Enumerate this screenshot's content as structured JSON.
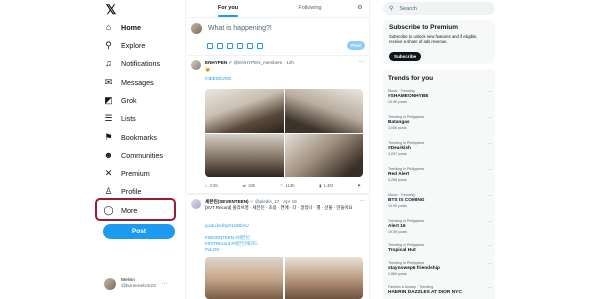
{
  "sidebar": {
    "logo": "𝕏",
    "items": [
      {
        "label": "Home",
        "icon": "home-icon"
      },
      {
        "label": "Explore",
        "icon": "search-icon"
      },
      {
        "label": "Notifications",
        "icon": "bell-icon"
      },
      {
        "label": "Messages",
        "icon": "mail-icon"
      },
      {
        "label": "Grok",
        "icon": "grok-icon"
      },
      {
        "label": "Lists",
        "icon": "list-icon"
      },
      {
        "label": "Bookmarks",
        "icon": "bookmark-icon"
      },
      {
        "label": "Communities",
        "icon": "people-icon"
      },
      {
        "label": "Premium",
        "icon": "x-icon"
      },
      {
        "label": "Profile",
        "icon": "person-icon"
      },
      {
        "label": "More",
        "icon": "more-circle-icon"
      }
    ],
    "post_label": "Post",
    "account": {
      "name": "Melvin",
      "handle": "@bonemelvin23"
    }
  },
  "timeline": {
    "tabs": [
      {
        "label": "For you"
      },
      {
        "label": "Following"
      }
    ],
    "compose": {
      "placeholder": "What is happening?!",
      "post_label": "Post"
    },
    "tweets": [
      {
        "name": "ENHYPEN",
        "handle": "@ENHYPEN_members · 12h",
        "text": "😺",
        "hashtag": "#JEESEUNG",
        "stats": {
          "replies": "3.0K",
          "reposts": "18K",
          "likes": "113K",
          "views": "1.4M"
        }
      },
      {
        "name": "세븐틴(SEVENTEEN)",
        "handle": "@pledis_17 · Apr 18",
        "text": "[SVT Record] 올리브영 · 세븐틴 · 조용 · 연애 · 다 · 알았나 · 별 · 선물 · 만들어요",
        "link": "youtu.be/hpO1sWbAU",
        "hashtags": "#SEVENTEEN #세븐틴",
        "hashtags2": "#SVTRecord #세븐틴레코드",
        "hashtags3": "#VLOG"
      }
    ]
  },
  "right": {
    "search_placeholder": "Search",
    "premium": {
      "title": "Subscribe to Premium",
      "desc": "Subscribe to unlock new features and if eligible, receive a share of ads revenue.",
      "button": "Subscribe"
    },
    "trends_title": "Trends for you",
    "trends": [
      {
        "context": "Music · Trending",
        "name": "#SHAMEONHYBE",
        "count": "19.9K posts"
      },
      {
        "context": "Trending in Philippines",
        "name": "Batangas",
        "count": "3,006 posts"
      },
      {
        "context": "Trending in Philippines",
        "name": "#Dearkish",
        "count": "4,297 posts"
      },
      {
        "context": "Trending in Philippines",
        "name": "Red Alert",
        "count": "5,258 posts"
      },
      {
        "context": "Music · Trending",
        "name": "BTS IS COMING",
        "count": "19.9K posts"
      },
      {
        "context": "Trending in Philippines",
        "name": "Alert 16",
        "count": "19.3K posts"
      },
      {
        "context": "Trending in Philippines",
        "name": "Tropical Hut",
        "count": ""
      },
      {
        "context": "Trending in Philippines",
        "name": "staynowep6 friendship",
        "count": "2,860 posts"
      },
      {
        "context": "Fashion & beauty · Trending",
        "name": "HAERIN DAZZLES AT DIOR NYC",
        "count": ""
      }
    ]
  }
}
